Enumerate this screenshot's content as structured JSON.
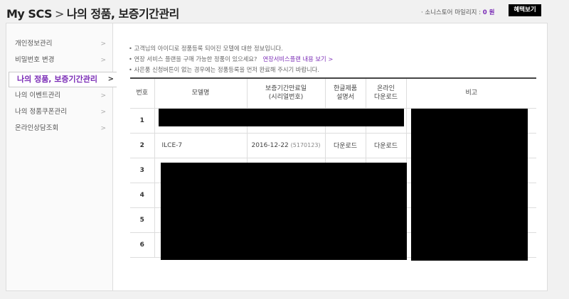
{
  "header": {
    "home": "My SCS",
    "separator": ">",
    "page_title": "나의 정품, 보증기간관리",
    "mileage_label": "· 소니스토어 마일리지 :",
    "mileage_value": "0 원",
    "benefit_button": "혜택보기"
  },
  "sidebar": {
    "items": [
      {
        "label": "개인정보관리",
        "active": false
      },
      {
        "label": "비밀번호 변경",
        "active": false
      },
      {
        "label": "나의 정품, 보증기간관리",
        "active": true
      },
      {
        "label": "나의 이벤트관리",
        "active": false
      },
      {
        "label": "나의 정품쿠폰관리",
        "active": false
      },
      {
        "label": "온라인상담조회",
        "active": false
      }
    ],
    "chevron": ">"
  },
  "notices": {
    "line1": "• 고객님의 아이디로 정품등록 되어진 모델에 대한 정보입니다.",
    "line2": "• 연장 서비스 플랜을 구매 가능한 정품이 있으세요?",
    "line2_link": "연장서비스플랜 내용 보기 >",
    "line3": "• 사은품 신청버튼이 없는 경우에는 정품등록을 먼저 완료해 주시기 바랍니다."
  },
  "table": {
    "headers": {
      "no": "번호",
      "model": "모델명",
      "warranty_line1": "보증기간만료일",
      "warranty_line2": "(시리얼번호)",
      "manual_line1": "한글제품",
      "manual_line2": "설명서",
      "online_line1": "온라인",
      "online_line2": "다운로드",
      "note": "비고"
    },
    "rows": [
      {
        "no": "1",
        "model": "",
        "date": "",
        "serial": "",
        "manual": "",
        "online": ""
      },
      {
        "no": "2",
        "model": "ILCE-7",
        "date": "2016-12-22",
        "serial": "(5170123)",
        "manual": "다운로드",
        "online": "다운로드"
      },
      {
        "no": "3",
        "model": "",
        "date": "",
        "serial": "",
        "manual": "",
        "online": ""
      },
      {
        "no": "4",
        "model": "",
        "date": "",
        "serial": "",
        "manual": "",
        "online": ""
      },
      {
        "no": "5",
        "model": "",
        "date": "",
        "serial": "",
        "manual": "",
        "online": ""
      },
      {
        "no": "6",
        "model": "",
        "date": "",
        "serial": "",
        "manual": "",
        "online": ""
      }
    ]
  },
  "colors": {
    "accent": "#7a2bb6",
    "redaction": "#000000"
  }
}
